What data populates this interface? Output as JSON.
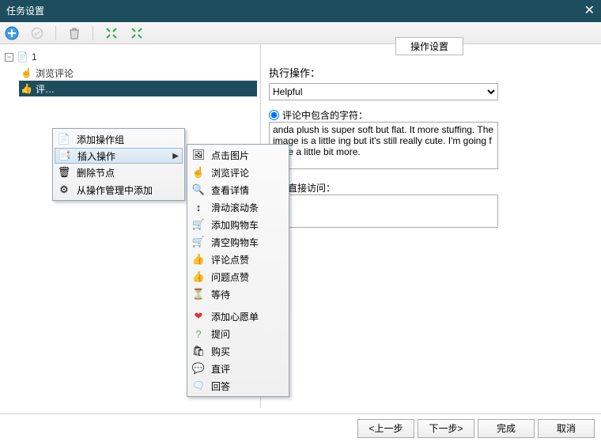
{
  "title": "任务设置",
  "tree": {
    "root": "1",
    "item1": "浏览评论",
    "item2": "评…"
  },
  "tab_label": "操作设置",
  "labels": {
    "exec_op": "执行操作：",
    "contains": "评论中包含的字符：",
    "direct_visit": "链接直接访问："
  },
  "select_value": "Helpful",
  "textarea_value": "anda plush is super soft but flat. It more stuffing. The image is a little ing but it's still really cute. I'm going f mine a little bit more.",
  "context1": {
    "add_group": "添加操作组",
    "insert_op": "插入操作",
    "delete_node": "删除节点",
    "add_from_mgr": "从操作管理中添加"
  },
  "context2": {
    "click_img": "点击图片",
    "browse_review": "浏览评论",
    "view_detail": "查看详情",
    "scroll_bar": "滑动滚动条",
    "add_cart": "添加购物车",
    "clear_cart": "清空购物车",
    "review_like": "评论点赞",
    "qa_like": "问题点赞",
    "wait": "等待",
    "add_wishlist": "添加心愿单",
    "ask": "提问",
    "buy": "购买",
    "direct_review": "直评",
    "reply": "回答"
  },
  "buttons": {
    "prev": "<上一步",
    "next": "下一步>",
    "done": "完成",
    "cancel": "取消"
  }
}
